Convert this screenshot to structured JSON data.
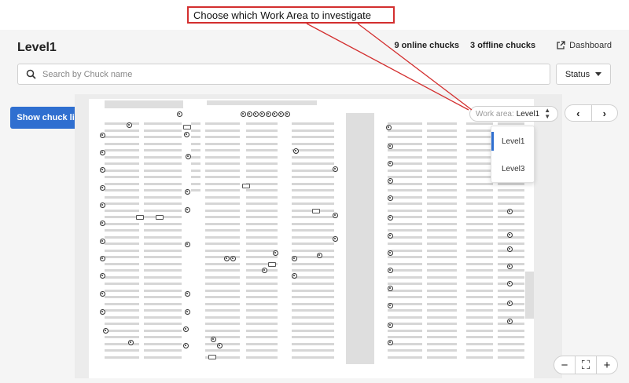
{
  "annotation": {
    "text": "Choose which Work Area to investigate",
    "color": "#d32f2f"
  },
  "header": {
    "title": "Level1",
    "online": "9 online chucks",
    "offline": "3 offline chucks",
    "dashboard": "Dashboard"
  },
  "search": {
    "placeholder": "Search by Chuck name",
    "value": ""
  },
  "status_filter": {
    "label": "Status"
  },
  "sidebar": {
    "show_list": "Show chuck list"
  },
  "work_area": {
    "label": "Work area:",
    "selected": "Level1",
    "options": [
      {
        "label": "Level1",
        "active": true
      },
      {
        "label": "Level3",
        "active": false
      }
    ]
  },
  "nav": {
    "prev": "‹",
    "next": "›"
  },
  "zoom": {
    "out": "−",
    "fit": "⛶",
    "in": "+"
  },
  "colors": {
    "accent": "#2f6fd0",
    "annotation": "#d32f2f"
  },
  "map": {
    "online_chucks": 9,
    "offline_chucks": 3
  }
}
